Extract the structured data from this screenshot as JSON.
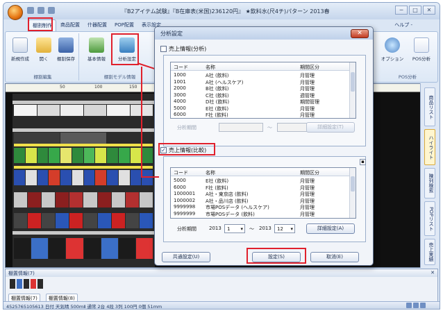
{
  "app": {
    "window_title": "『B2アイテム試験』『B在庫表(米国)236120円』 ★飲料水(尺4チ)パターン 2013春夏 - 棚 POWER",
    "window_buttons": [
      "─",
      "□",
      "✕"
    ],
    "ribbon_tabs": [
      "棚割制作",
      "商品配置",
      "什器配置",
      "POP配置",
      "表示設定"
    ],
    "ribbon_right": "ヘルプ -",
    "ribbon_groups": {
      "edit": {
        "label": "棚割編集",
        "buttons": [
          "新規作成",
          "開く",
          "棚割保存"
        ]
      },
      "model": {
        "label": "棚割モデル情報",
        "buttons": [
          "基本情報",
          "分析設定"
        ]
      },
      "right": {
        "label": "POS分析",
        "buttons": [
          "オプション",
          "POS分析"
        ]
      }
    },
    "ruler_marks": [
      "50",
      "100",
      "150"
    ],
    "side_tabs": [
      "商品リスト",
      "ハイライト",
      "陳列検索",
      "POPリスト",
      "売上実績"
    ],
    "bottom_pane": {
      "title": "棚置情報(7)",
      "close": "✕",
      "tabs": [
        "棚置情報(7)",
        "棚置情報(8)"
      ]
    },
    "statusbar": "4525765105613 日付 天気晴 500mⅡ 通常 2台 4段 3列 100円 0個 51mm"
  },
  "dialog": {
    "title": "分析設定",
    "close": "✕",
    "section1": {
      "checkbox_label": "売上情報(分析)",
      "checked": false,
      "columns": [
        "コード",
        "名称",
        "期間区分"
      ],
      "rows": [
        [
          "1000",
          "A社 (飲料)",
          "月管理"
        ],
        [
          "1001",
          "A社 (ヘルスケア)",
          "月管理"
        ],
        [
          "2000",
          "B社 (飲料)",
          "月管理"
        ],
        [
          "3000",
          "C社 (飲料)",
          "週管理"
        ],
        [
          "4000",
          "D社 (飲料)",
          "期間管理"
        ],
        [
          "5000",
          "E社 (飲料)",
          "月管理"
        ],
        [
          "6000",
          "F社 (飲料)",
          "月管理"
        ]
      ],
      "period_label": "分析期間",
      "tilde": "～",
      "detail_button": "詳細設定(T)"
    },
    "section2": {
      "checkbox_label": "売上情報(比較)",
      "checked": true,
      "check_mark": "✓",
      "expand": "▪",
      "columns": [
        "コード",
        "名称",
        "期間区分"
      ],
      "rows": [
        [
          "5000",
          "E社 (飲料)",
          "月管理"
        ],
        [
          "6000",
          "F社 (飲料)",
          "月管理"
        ],
        [
          "1000001",
          "A社・東京店 (飲料)",
          "月管理"
        ],
        [
          "1000002",
          "A社・品川店 (飲料)",
          "月管理"
        ],
        [
          "9999998",
          "市場POSデータ (ヘルスケア)",
          "月管理"
        ],
        [
          "9999999",
          "市場POSデータ (飲料)",
          "月管理"
        ]
      ],
      "period_label": "分析期間",
      "from_year": "2013",
      "from_month": "1",
      "tilde": "～",
      "to_year": "2013",
      "to_month": "12",
      "detail_button": "詳細設定(A)"
    },
    "common_button": "共通設定(U)",
    "ok_button": "設定(S)",
    "cancel_button": "取消(E)"
  },
  "colors": {
    "highlight": "#e0202c",
    "titlebar": "#c6d6ec",
    "dialog_bg": "#f1f4f9"
  }
}
